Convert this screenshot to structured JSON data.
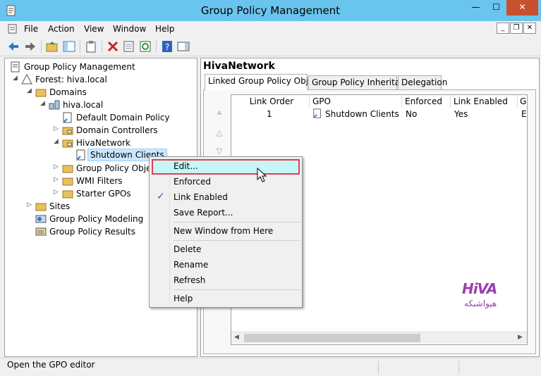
{
  "window": {
    "title": "Group Policy Management"
  },
  "menu": [
    "File",
    "Action",
    "View",
    "Window",
    "Help"
  ],
  "tree": {
    "root": "Group Policy Management",
    "forest": "Forest: hiva.local",
    "domains": "Domains",
    "domain": "hiva.local",
    "default_policy": "Default Domain Policy",
    "domain_controllers": "Domain Controllers",
    "ou": "HivaNetwork",
    "selected_gpo": "Shutdown Clients",
    "gpo_objects": "Group Policy Objects",
    "wmi_filters": "WMI Filters",
    "starter_gpos": "Starter GPOs",
    "sites": "Sites",
    "modeling": "Group Policy Modeling",
    "results": "Group Policy Results"
  },
  "right": {
    "title": "HivaNetwork",
    "tabs": [
      "Linked Group Policy Objects",
      "Group Policy Inheritance",
      "Delegation"
    ],
    "columns": [
      "Link Order",
      "GPO",
      "Enforced",
      "Link Enabled",
      "G"
    ],
    "rows": [
      {
        "order": "1",
        "gpo": "Shutdown Clients",
        "enforced": "No",
        "link_enabled": "Yes",
        "extra": "E"
      }
    ]
  },
  "context_menu": {
    "edit": "Edit...",
    "enforced": "Enforced",
    "link_enabled": "Link Enabled",
    "save_report": "Save Report...",
    "new_window": "New Window from Here",
    "delete": "Delete",
    "rename": "Rename",
    "refresh": "Refresh",
    "help": "Help"
  },
  "status": {
    "text": "Open the GPO editor"
  },
  "watermark": {
    "logo": "HiVA",
    "sub": "هیواشبکه"
  },
  "colors": {
    "titlebar": "#6ac5ee",
    "close": "#c7502f",
    "highlight_border": "#e04050",
    "highlight_fill": "#c6f6f6"
  }
}
